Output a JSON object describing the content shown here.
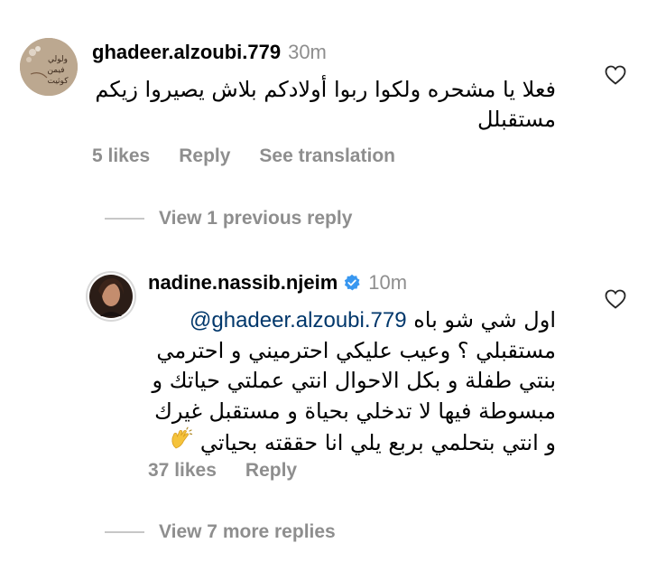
{
  "comment1": {
    "username": "ghadeer.alzoubi.779",
    "time": "30m",
    "text_line1": "فعلا يا مشحره ولكوا ربوا أولادكم بلاش يصيروا زيكم",
    "text_line2": "مستقبلل",
    "likes": "5 likes",
    "reply_label": "Reply",
    "translation_label": "See translation",
    "avatar_text": "ولولي فيمن كوثيت"
  },
  "view_previous": "View 1 previous reply",
  "comment2": {
    "username": "nadine.nassib.njeim",
    "verified": true,
    "time": "10m",
    "mention": "@ghadeer.alzoubi.779",
    "line1_text": "اول شي شو باه",
    "line2": "مستقبلي ؟ وعيب عليكي احترميني و احترمي",
    "line3": "بنتي طفلة و بكل الاحوال انتي عملتي حياتك و",
    "line4": "مبسوطة فيها لا تدخلي بحياة و مستقبل غيرك",
    "line5": "و انتي بتحلمي بربع يلي انا حققته بحياتي",
    "emoji": "👏",
    "likes": "37 likes",
    "reply_label": "Reply"
  },
  "view_more": "View 7 more replies",
  "colors": {
    "secondary": "#8e8e8e",
    "mention": "#00376b",
    "verified": "#3897f0",
    "divider": "#c7c7c7"
  }
}
